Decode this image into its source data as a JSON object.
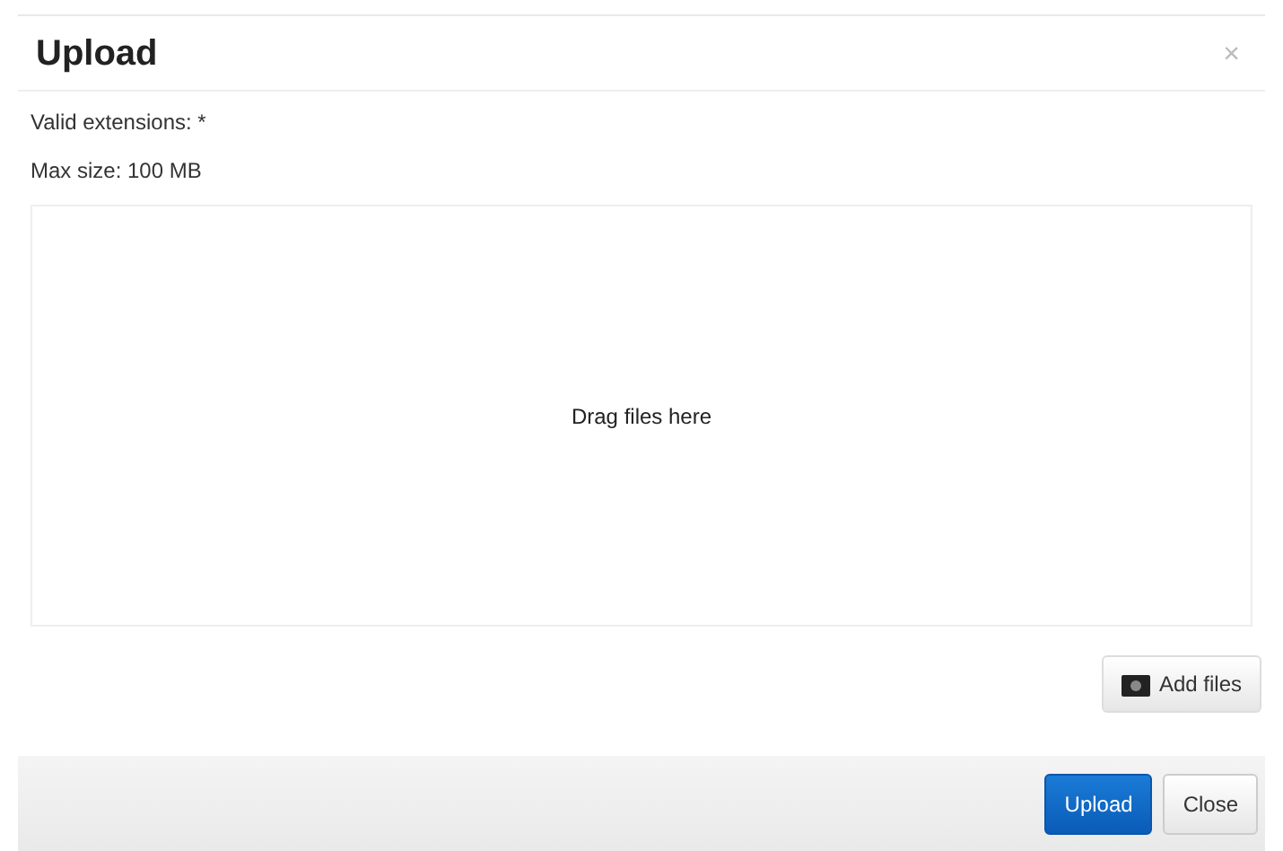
{
  "dialog": {
    "title": "Upload",
    "close": "×"
  },
  "info": [
    "Valid extensions: *",
    "Max size: 100 MB"
  ],
  "dropzone": {
    "text": "Drag files here"
  },
  "add_files": {
    "label": "Add files"
  },
  "buttons": [
    {
      "label": "Upload",
      "kind": "primary"
    },
    {
      "label": "Close",
      "kind": "default"
    }
  ]
}
